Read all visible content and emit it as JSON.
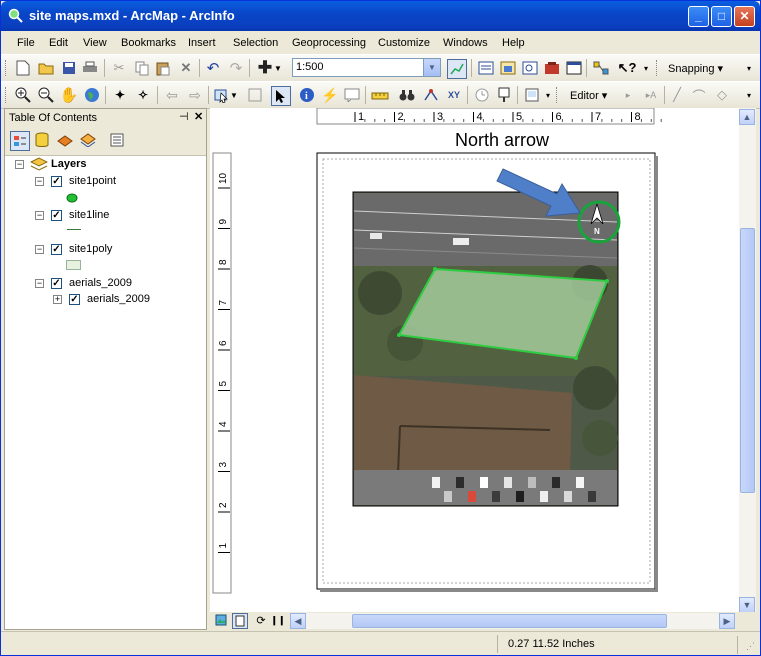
{
  "window": {
    "title": "site maps.mxd - ArcMap - ArcInfo"
  },
  "menu": [
    "File",
    "Edit",
    "View",
    "Bookmarks",
    "Insert",
    "Selection",
    "Geoprocessing",
    "Customize",
    "Windows",
    "Help"
  ],
  "toolbar": {
    "scale_value": "1:500",
    "snapping_label": "Snapping ▾",
    "editor_label": "Editor ▾"
  },
  "toc": {
    "title": "Table Of Contents",
    "root_label": "Layers",
    "layers": [
      {
        "name": "site1point",
        "symbol": "point",
        "color": "#22C033"
      },
      {
        "name": "site1line",
        "symbol": "line",
        "color": "#3A7A3A"
      },
      {
        "name": "site1poly",
        "symbol": "polygon",
        "color": "#E6F2DF"
      },
      {
        "name": "aerials_2009",
        "symbol": "group"
      },
      {
        "name": "aerials_2009",
        "symbol": "raster"
      }
    ]
  },
  "ruler": {
    "h_ticks": [
      "1",
      "2",
      "3",
      "4",
      "5",
      "6",
      "7",
      "8"
    ],
    "v_ticks": [
      "10",
      "9",
      "8",
      "7",
      "6",
      "5",
      "4",
      "3",
      "2",
      "1"
    ]
  },
  "annotation": {
    "text": "North arrow"
  },
  "north_arrow": {
    "letter": "N"
  },
  "status": {
    "coords": "0.27  11.52 Inches"
  },
  "colors": {
    "title_bar": "#0A5FE0",
    "highlight_circle": "#17A43A",
    "callout_arrow": "#4F7FC8",
    "parcel_outline": "#2ECC40"
  }
}
